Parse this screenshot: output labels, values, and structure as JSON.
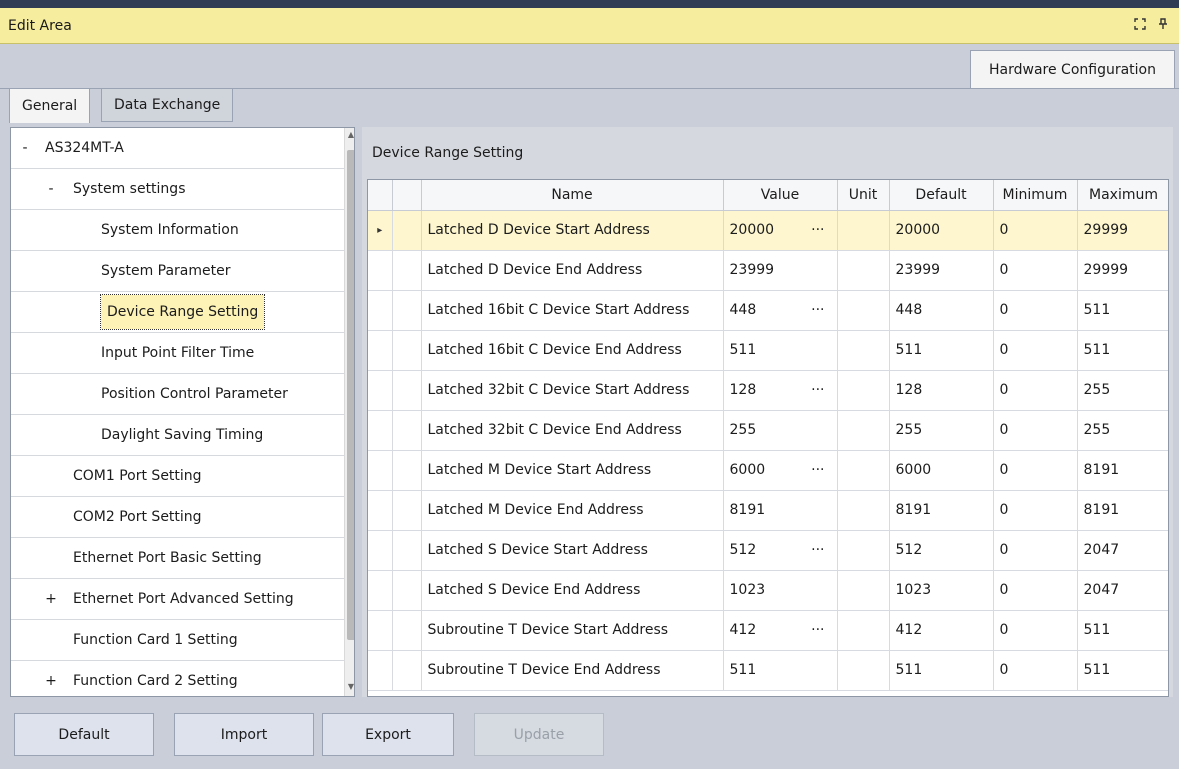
{
  "window": {
    "title": "Edit Area"
  },
  "doc_tab": {
    "label": "Hardware Configuration"
  },
  "tabs": [
    {
      "label": "General"
    },
    {
      "label": "Data Exchange"
    }
  ],
  "tree": {
    "items": [
      {
        "label": "AS324MT-A",
        "toggle": "-"
      },
      {
        "label": "System settings",
        "toggle": "-"
      },
      {
        "label": "System Information",
        "toggle": ""
      },
      {
        "label": "System Parameter",
        "toggle": ""
      },
      {
        "label": "Device Range Setting",
        "toggle": ""
      },
      {
        "label": "Input Point Filter Time",
        "toggle": ""
      },
      {
        "label": "Position Control Parameter",
        "toggle": ""
      },
      {
        "label": "Daylight Saving Timing",
        "toggle": ""
      },
      {
        "label": "COM1 Port Setting",
        "toggle": ""
      },
      {
        "label": "COM2 Port Setting",
        "toggle": ""
      },
      {
        "label": "Ethernet Port Basic Setting",
        "toggle": ""
      },
      {
        "label": "Ethernet Port Advanced Setting",
        "toggle": "+"
      },
      {
        "label": "Function Card 1 Setting",
        "toggle": ""
      },
      {
        "label": "Function Card 2 Setting",
        "toggle": "+"
      }
    ]
  },
  "panel": {
    "title": "Device Range Setting"
  },
  "grid": {
    "columns": [
      "Name",
      "Value",
      "Unit",
      "Default",
      "Minimum",
      "Maximum"
    ],
    "rows": [
      {
        "name": "Latched D Device Start Address",
        "value": "20000",
        "ellipsis": "···",
        "unit": "",
        "default": "20000",
        "min": "0",
        "max": "29999",
        "indicator": "▸"
      },
      {
        "name": "Latched D Device End Address",
        "value": "23999",
        "ellipsis": "",
        "unit": "",
        "default": "23999",
        "min": "0",
        "max": "29999",
        "indicator": ""
      },
      {
        "name": "Latched 16bit C Device Start Address",
        "value": "448",
        "ellipsis": "···",
        "unit": "",
        "default": "448",
        "min": "0",
        "max": "511",
        "indicator": ""
      },
      {
        "name": "Latched 16bit C Device End Address",
        "value": "511",
        "ellipsis": "",
        "unit": "",
        "default": "511",
        "min": "0",
        "max": "511",
        "indicator": ""
      },
      {
        "name": "Latched 32bit C Device Start Address",
        "value": "128",
        "ellipsis": "···",
        "unit": "",
        "default": "128",
        "min": "0",
        "max": "255",
        "indicator": ""
      },
      {
        "name": "Latched 32bit C Device End Address",
        "value": "255",
        "ellipsis": "",
        "unit": "",
        "default": "255",
        "min": "0",
        "max": "255",
        "indicator": ""
      },
      {
        "name": "Latched M Device Start Address",
        "value": "6000",
        "ellipsis": "···",
        "unit": "",
        "default": "6000",
        "min": "0",
        "max": "8191",
        "indicator": ""
      },
      {
        "name": "Latched M Device End Address",
        "value": "8191",
        "ellipsis": "",
        "unit": "",
        "default": "8191",
        "min": "0",
        "max": "8191",
        "indicator": ""
      },
      {
        "name": "Latched S Device Start Address",
        "value": "512",
        "ellipsis": "···",
        "unit": "",
        "default": "512",
        "min": "0",
        "max": "2047",
        "indicator": ""
      },
      {
        "name": "Latched S Device End Address",
        "value": "1023",
        "ellipsis": "",
        "unit": "",
        "default": "1023",
        "min": "0",
        "max": "2047",
        "indicator": ""
      },
      {
        "name": "Subroutine T Device Start Address",
        "value": "412",
        "ellipsis": "···",
        "unit": "",
        "default": "412",
        "min": "0",
        "max": "511",
        "indicator": ""
      },
      {
        "name": "Subroutine T Device End Address",
        "value": "511",
        "ellipsis": "",
        "unit": "",
        "default": "511",
        "min": "0",
        "max": "511",
        "indicator": ""
      }
    ]
  },
  "buttons": {
    "default": "Default",
    "import": "Import",
    "export": "Export",
    "update": "Update"
  },
  "icons": {
    "maximize": "maximize-icon",
    "pin": "pin-icon"
  },
  "colors": {
    "title_bar": "#f6ee9e",
    "selection": "#fdf3b7"
  }
}
